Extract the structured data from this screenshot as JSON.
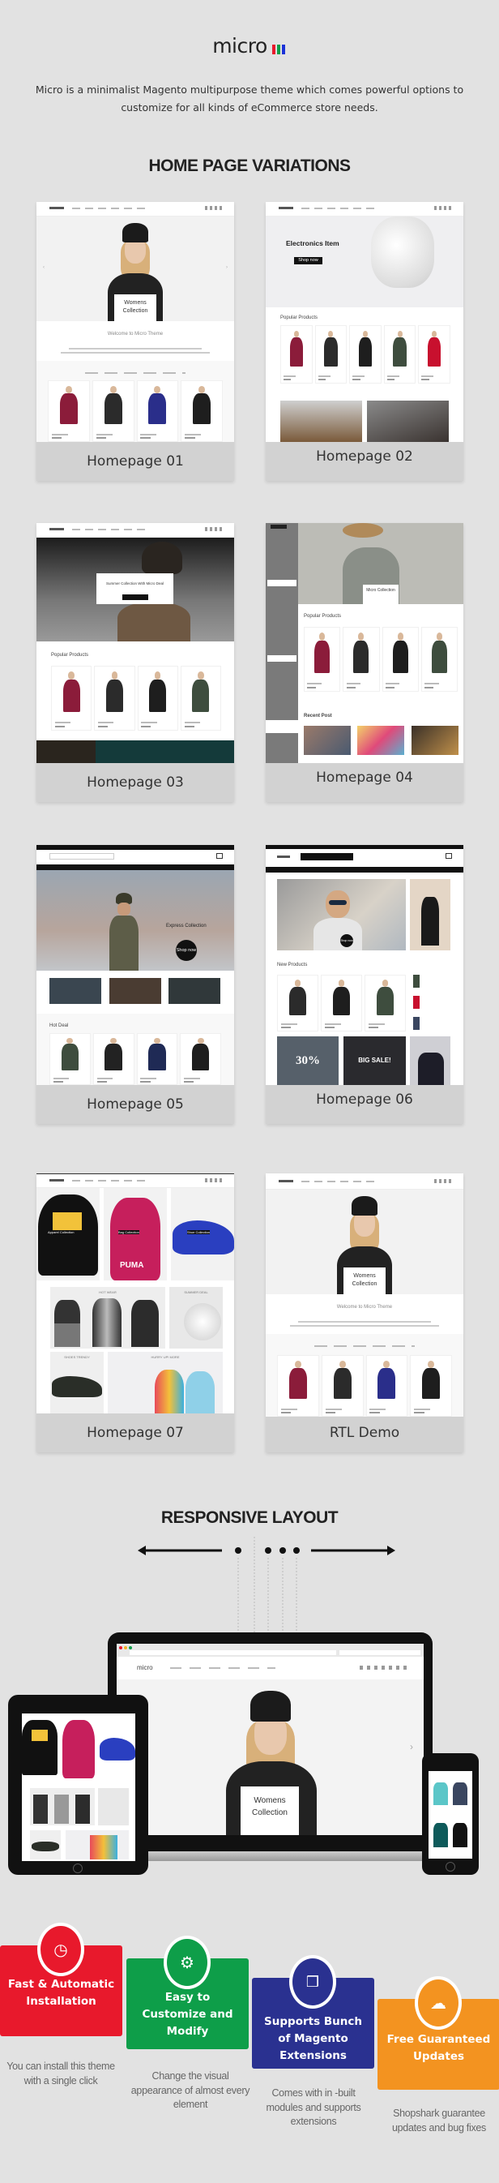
{
  "header": {
    "logo_text": "micro",
    "logo_colors": [
      "#e8192c",
      "#0e9e49",
      "#1a32d8"
    ],
    "description": "Micro is a minimalist Magento multipurpose theme which comes powerful options to customize for all kinds of eCommerce store needs."
  },
  "variations": {
    "title": "HOME PAGE VARIATIONS",
    "items": [
      {
        "label": "Homepage 01",
        "hero_box": "Womens Collection",
        "welcome": "Welcome to Micro Theme",
        "products": [
          "#8b1c3a",
          "#2b2b2b",
          "#2a2e8a",
          "#1e1e1e"
        ]
      },
      {
        "label": "Homepage 02",
        "hero_title": "Electronics Item",
        "hero_button": "Shop now",
        "section": "Popular Products",
        "products": [
          "#8b1c3a",
          "#2b2b2b",
          "#1e1e1e",
          "#3e4d3e",
          "#c8102e"
        ]
      },
      {
        "label": "Homepage 03",
        "hero_box": "Summer Collection With Micro Deal",
        "section": "Popular Products",
        "products": [
          "#8b1c3a",
          "#2b2b2b",
          "#1e1e1e",
          "#3e4d3e"
        ]
      },
      {
        "label": "Homepage 04",
        "hero_box": "Micro Collection",
        "section": "Popular Products",
        "section2": "Recent Post",
        "products": [
          "#8b1c3a",
          "#2b2b2b",
          "#1e1e1e",
          "#3e4d3e"
        ]
      },
      {
        "label": "Homepage 05",
        "hero_title": "Express Collection",
        "hero_button": "Shop now",
        "section": "Hot Deal",
        "products": [
          "#3e4d3e",
          "#222222",
          "#1f2a55",
          "#1e1e1e"
        ]
      },
      {
        "label": "Homepage 06",
        "hero_button": "Shop now",
        "section": "New Products",
        "banner1": "30%",
        "banner2": "BIG SALE!",
        "products": [
          "#2b2b2b",
          "#1e1e1e",
          "#3e4d3e"
        ]
      },
      {
        "label": "Homepage 07",
        "brand": "PUMA",
        "tile1": "Apparel Collection",
        "tile2": "Bag Collection",
        "tile3": "Shoe Collection",
        "tile4": "HOT WEAR",
        "tile5": "SUMMER DEAL",
        "tile6": "SHOES TRENDY",
        "tile7": "HURRY UP! MORE"
      },
      {
        "label": "RTL Demo",
        "hero_box": "Womens Collection",
        "welcome": "Welcome to Micro Theme",
        "products": [
          "#8b1c3a",
          "#2b2b2b",
          "#2a2e8a",
          "#1e1e1e"
        ]
      }
    ]
  },
  "responsive": {
    "title": "RESPONSIVE LAYOUT",
    "laptop_logo": "micro",
    "hero_box": "Womens Collection"
  },
  "features": [
    {
      "title": "Fast & Automatic Installation",
      "description": "You can install this theme with a single click",
      "icon": "clock-icon",
      "color": "#e8192c"
    },
    {
      "title": "Easy to Customize and Modify",
      "description": "Change the visual appearance of almost every element",
      "icon": "gears-icon",
      "color": "#0e9e49"
    },
    {
      "title": "Supports Bunch of Magento Extensions",
      "description": "Comes with in -built modules and supports extensions",
      "icon": "cubes-icon",
      "color": "#2a3190"
    },
    {
      "title": "Free Guaranteed Updates",
      "description": "Shopshark guarantee updates and bug fixes",
      "icon": "cloud-download-icon",
      "color": "#f39320"
    }
  ]
}
